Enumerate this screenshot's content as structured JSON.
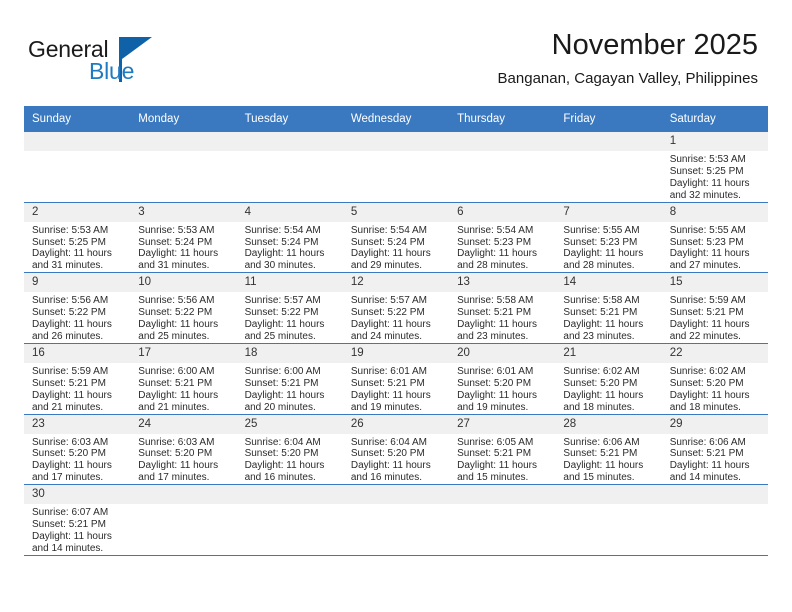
{
  "brand": {
    "name_part1": "General",
    "name_part2": "Blue",
    "logo_icon": "blue-triangle-flag",
    "color_dark": "#1a1a1a",
    "color_blue": "#1f7bc1"
  },
  "header": {
    "title": "November 2025",
    "subtitle": "Banganan, Cagayan Valley, Philippines"
  },
  "theme": {
    "header_bg": "#3a79c0",
    "header_text": "#ffffff",
    "daynum_bg": "#f0f0f0",
    "row_border": "#3a79c0"
  },
  "calendar": {
    "weekdays": [
      "Sunday",
      "Monday",
      "Tuesday",
      "Wednesday",
      "Thursday",
      "Friday",
      "Saturday"
    ],
    "weeks": [
      [
        {
          "day": "",
          "lines": []
        },
        {
          "day": "",
          "lines": []
        },
        {
          "day": "",
          "lines": []
        },
        {
          "day": "",
          "lines": []
        },
        {
          "day": "",
          "lines": []
        },
        {
          "day": "",
          "lines": []
        },
        {
          "day": "1",
          "lines": [
            "Sunrise: 5:53 AM",
            "Sunset: 5:25 PM",
            "Daylight: 11 hours",
            "and 32 minutes."
          ]
        }
      ],
      [
        {
          "day": "2",
          "lines": [
            "Sunrise: 5:53 AM",
            "Sunset: 5:25 PM",
            "Daylight: 11 hours",
            "and 31 minutes."
          ]
        },
        {
          "day": "3",
          "lines": [
            "Sunrise: 5:53 AM",
            "Sunset: 5:24 PM",
            "Daylight: 11 hours",
            "and 31 minutes."
          ]
        },
        {
          "day": "4",
          "lines": [
            "Sunrise: 5:54 AM",
            "Sunset: 5:24 PM",
            "Daylight: 11 hours",
            "and 30 minutes."
          ]
        },
        {
          "day": "5",
          "lines": [
            "Sunrise: 5:54 AM",
            "Sunset: 5:24 PM",
            "Daylight: 11 hours",
            "and 29 minutes."
          ]
        },
        {
          "day": "6",
          "lines": [
            "Sunrise: 5:54 AM",
            "Sunset: 5:23 PM",
            "Daylight: 11 hours",
            "and 28 minutes."
          ]
        },
        {
          "day": "7",
          "lines": [
            "Sunrise: 5:55 AM",
            "Sunset: 5:23 PM",
            "Daylight: 11 hours",
            "and 28 minutes."
          ]
        },
        {
          "day": "8",
          "lines": [
            "Sunrise: 5:55 AM",
            "Sunset: 5:23 PM",
            "Daylight: 11 hours",
            "and 27 minutes."
          ]
        }
      ],
      [
        {
          "day": "9",
          "lines": [
            "Sunrise: 5:56 AM",
            "Sunset: 5:22 PM",
            "Daylight: 11 hours",
            "and 26 minutes."
          ]
        },
        {
          "day": "10",
          "lines": [
            "Sunrise: 5:56 AM",
            "Sunset: 5:22 PM",
            "Daylight: 11 hours",
            "and 25 minutes."
          ]
        },
        {
          "day": "11",
          "lines": [
            "Sunrise: 5:57 AM",
            "Sunset: 5:22 PM",
            "Daylight: 11 hours",
            "and 25 minutes."
          ]
        },
        {
          "day": "12",
          "lines": [
            "Sunrise: 5:57 AM",
            "Sunset: 5:22 PM",
            "Daylight: 11 hours",
            "and 24 minutes."
          ]
        },
        {
          "day": "13",
          "lines": [
            "Sunrise: 5:58 AM",
            "Sunset: 5:21 PM",
            "Daylight: 11 hours",
            "and 23 minutes."
          ]
        },
        {
          "day": "14",
          "lines": [
            "Sunrise: 5:58 AM",
            "Sunset: 5:21 PM",
            "Daylight: 11 hours",
            "and 23 minutes."
          ]
        },
        {
          "day": "15",
          "lines": [
            "Sunrise: 5:59 AM",
            "Sunset: 5:21 PM",
            "Daylight: 11 hours",
            "and 22 minutes."
          ]
        }
      ],
      [
        {
          "day": "16",
          "lines": [
            "Sunrise: 5:59 AM",
            "Sunset: 5:21 PM",
            "Daylight: 11 hours",
            "and 21 minutes."
          ]
        },
        {
          "day": "17",
          "lines": [
            "Sunrise: 6:00 AM",
            "Sunset: 5:21 PM",
            "Daylight: 11 hours",
            "and 21 minutes."
          ]
        },
        {
          "day": "18",
          "lines": [
            "Sunrise: 6:00 AM",
            "Sunset: 5:21 PM",
            "Daylight: 11 hours",
            "and 20 minutes."
          ]
        },
        {
          "day": "19",
          "lines": [
            "Sunrise: 6:01 AM",
            "Sunset: 5:21 PM",
            "Daylight: 11 hours",
            "and 19 minutes."
          ]
        },
        {
          "day": "20",
          "lines": [
            "Sunrise: 6:01 AM",
            "Sunset: 5:20 PM",
            "Daylight: 11 hours",
            "and 19 minutes."
          ]
        },
        {
          "day": "21",
          "lines": [
            "Sunrise: 6:02 AM",
            "Sunset: 5:20 PM",
            "Daylight: 11 hours",
            "and 18 minutes."
          ]
        },
        {
          "day": "22",
          "lines": [
            "Sunrise: 6:02 AM",
            "Sunset: 5:20 PM",
            "Daylight: 11 hours",
            "and 18 minutes."
          ]
        }
      ],
      [
        {
          "day": "23",
          "lines": [
            "Sunrise: 6:03 AM",
            "Sunset: 5:20 PM",
            "Daylight: 11 hours",
            "and 17 minutes."
          ]
        },
        {
          "day": "24",
          "lines": [
            "Sunrise: 6:03 AM",
            "Sunset: 5:20 PM",
            "Daylight: 11 hours",
            "and 17 minutes."
          ]
        },
        {
          "day": "25",
          "lines": [
            "Sunrise: 6:04 AM",
            "Sunset: 5:20 PM",
            "Daylight: 11 hours",
            "and 16 minutes."
          ]
        },
        {
          "day": "26",
          "lines": [
            "Sunrise: 6:04 AM",
            "Sunset: 5:20 PM",
            "Daylight: 11 hours",
            "and 16 minutes."
          ]
        },
        {
          "day": "27",
          "lines": [
            "Sunrise: 6:05 AM",
            "Sunset: 5:21 PM",
            "Daylight: 11 hours",
            "and 15 minutes."
          ]
        },
        {
          "day": "28",
          "lines": [
            "Sunrise: 6:06 AM",
            "Sunset: 5:21 PM",
            "Daylight: 11 hours",
            "and 15 minutes."
          ]
        },
        {
          "day": "29",
          "lines": [
            "Sunrise: 6:06 AM",
            "Sunset: 5:21 PM",
            "Daylight: 11 hours",
            "and 14 minutes."
          ]
        }
      ],
      [
        {
          "day": "30",
          "lines": [
            "Sunrise: 6:07 AM",
            "Sunset: 5:21 PM",
            "Daylight: 11 hours",
            "and 14 minutes."
          ]
        },
        {
          "day": "",
          "lines": []
        },
        {
          "day": "",
          "lines": []
        },
        {
          "day": "",
          "lines": []
        },
        {
          "day": "",
          "lines": []
        },
        {
          "day": "",
          "lines": []
        },
        {
          "day": "",
          "lines": []
        }
      ]
    ]
  }
}
